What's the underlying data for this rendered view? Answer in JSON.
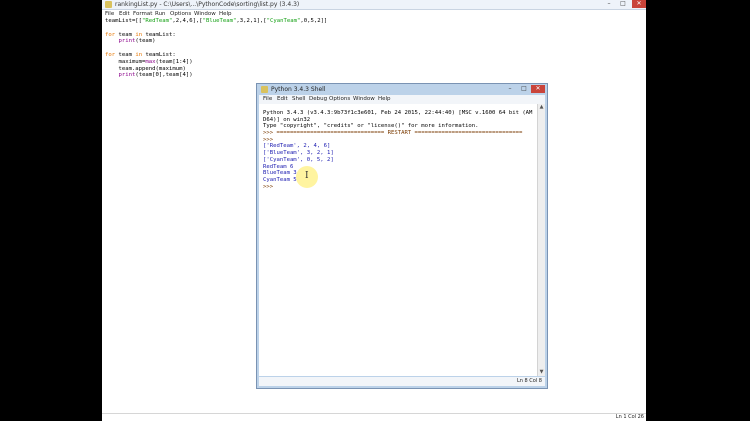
{
  "editor": {
    "title": "rankingList.py - C:\\Users\\...\\PythonCode\\sorting\\list.py (3.4.3)",
    "menu": [
      "File",
      "Edit",
      "Format",
      "Run",
      "Options",
      "Window",
      "Help"
    ],
    "status": "Ln 1 Col 26",
    "code": [
      {
        "segments": [
          {
            "t": "teamList=[[",
            "c": ""
          },
          {
            "t": "\"RedTeam\"",
            "c": "st"
          },
          {
            "t": ",2,4,6],[",
            "c": ""
          },
          {
            "t": "\"BlueTeam\"",
            "c": "st"
          },
          {
            "t": ",3,2,1],[",
            "c": ""
          },
          {
            "t": "\"CyanTeam\"",
            "c": "st"
          },
          {
            "t": ",0,5,2]]",
            "c": ""
          }
        ]
      },
      {
        "segments": [
          {
            "t": "",
            "c": ""
          }
        ]
      },
      {
        "segments": [
          {
            "t": "for",
            "c": "kw"
          },
          {
            "t": " team ",
            "c": ""
          },
          {
            "t": "in",
            "c": "kw"
          },
          {
            "t": " teamList:",
            "c": ""
          }
        ]
      },
      {
        "segments": [
          {
            "t": "    ",
            "c": ""
          },
          {
            "t": "print",
            "c": "bi"
          },
          {
            "t": "(team)",
            "c": ""
          }
        ]
      },
      {
        "segments": [
          {
            "t": "",
            "c": ""
          }
        ]
      },
      {
        "segments": [
          {
            "t": "for",
            "c": "kw"
          },
          {
            "t": " team ",
            "c": ""
          },
          {
            "t": "in",
            "c": "kw"
          },
          {
            "t": " teamList:",
            "c": ""
          }
        ]
      },
      {
        "segments": [
          {
            "t": "    maximum=",
            "c": ""
          },
          {
            "t": "max",
            "c": "bi"
          },
          {
            "t": "(team[1:4])",
            "c": ""
          }
        ]
      },
      {
        "segments": [
          {
            "t": "    team.append(maximum)",
            "c": ""
          }
        ]
      },
      {
        "segments": [
          {
            "t": "    ",
            "c": ""
          },
          {
            "t": "print",
            "c": "bi"
          },
          {
            "t": "(team[0],team[4])",
            "c": ""
          }
        ]
      }
    ]
  },
  "shell": {
    "title": "Python 3.4.3 Shell",
    "menu": [
      "File",
      "Edit",
      "Shell",
      "Debug",
      "Options",
      "Window",
      "Help"
    ],
    "status": "Ln 8 Col 8",
    "lines": [
      {
        "segments": [
          {
            "t": "Python 3.4.3 (v3.4.3:9b73f1c3e601, Feb 24 2015, 22:44:40) [MSC v.1600 64 bit (AM",
            "c": ""
          }
        ]
      },
      {
        "segments": [
          {
            "t": "D64)] on win32",
            "c": ""
          }
        ]
      },
      {
        "segments": [
          {
            "t": "Type \"copyright\", \"credits\" or \"license()\" for more information.",
            "c": ""
          }
        ]
      },
      {
        "segments": [
          {
            "t": ">>> ================================ RESTART ================================",
            "c": "prompt"
          }
        ]
      },
      {
        "segments": [
          {
            "t": ">>>",
            "c": "prompt"
          }
        ]
      },
      {
        "segments": [
          {
            "t": "['RedTeam', 2, 4, 6]",
            "c": "out"
          }
        ]
      },
      {
        "segments": [
          {
            "t": "['BlueTeam', 3, 2, 1]",
            "c": "out"
          }
        ]
      },
      {
        "segments": [
          {
            "t": "['CyanTeam', 0, 5, 2]",
            "c": "out"
          }
        ]
      },
      {
        "segments": [
          {
            "t": "RedTeam 6",
            "c": "out"
          }
        ]
      },
      {
        "segments": [
          {
            "t": "BlueTeam 3",
            "c": "out"
          }
        ]
      },
      {
        "segments": [
          {
            "t": "CyanTeam 5",
            "c": "out"
          }
        ]
      },
      {
        "segments": [
          {
            "t": ">>> ",
            "c": "prompt"
          }
        ]
      }
    ]
  },
  "window_controls": {
    "minimize": "–",
    "maximize": "□",
    "close": "✕"
  }
}
